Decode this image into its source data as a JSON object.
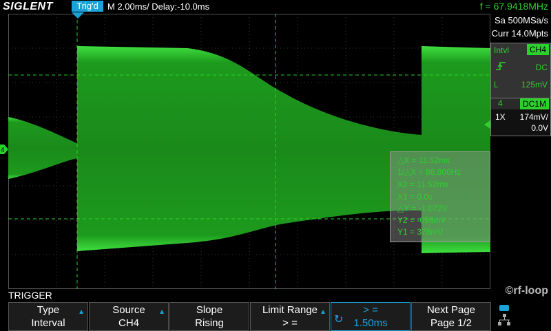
{
  "brand": "SIGLENT",
  "status": {
    "trigger_state": "Trig'd",
    "timebase": "M 2.00ms/ Delay:-10.0ms",
    "frequency": "f = 67.9418MHz"
  },
  "acquisition": {
    "sample_rate": "Sa 500MSa/s",
    "memory": "Curr 14.0Mpts"
  },
  "trigger_info": {
    "mode": "Intvl",
    "source": "CH4",
    "slope_icon": "rising-edge-icon",
    "coupling": "DC",
    "level_label": "L",
    "level": "125mV"
  },
  "channel": {
    "number": "4",
    "coupling": "DC1M",
    "probe": "1X",
    "scale": "174mV/",
    "offset": "0.0V",
    "marker": "4"
  },
  "measurements": [
    "△X = 11.52ms",
    "1/△X = 86.806Hz",
    "X2 = 11.52ms",
    "X1 = 0.0s",
    "△Y = -1.072V",
    "Y2 = -696mV",
    "Y1 = 376mV"
  ],
  "menu_title": "TRIGGER",
  "watermark": "©rf-loop",
  "softkeys": [
    {
      "line1": "Type",
      "line2": "Interval"
    },
    {
      "line1": "Source",
      "line2": "CH4"
    },
    {
      "line1": "Slope",
      "line2": "Rising"
    },
    {
      "line1": "Limit Range",
      "line2": "> ="
    },
    {
      "line1": ">  =",
      "line2": "1.50ms"
    },
    {
      "line1": "Next Page",
      "line2": "Page 1/2"
    }
  ],
  "colors": {
    "trace": "#2cd12c",
    "accent": "#1aa3d9",
    "grid": "#3a3a3a"
  },
  "icons": [
    "trigger-position-icon",
    "channel-marker-icon",
    "knob-icon",
    "network-icon"
  ]
}
